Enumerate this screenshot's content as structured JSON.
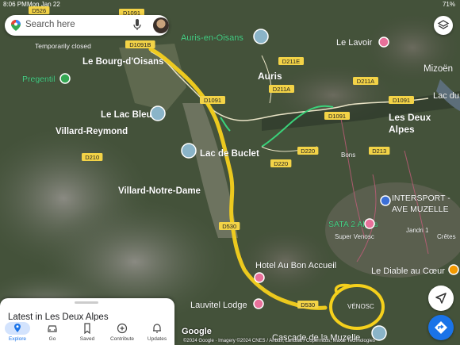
{
  "status_bar": {
    "time": "8:06 PM",
    "date": "Mon Jan 22",
    "battery": "71%"
  },
  "search": {
    "placeholder": "Search here"
  },
  "map": {
    "places": [
      {
        "name": "Le Bourg-d'Oisans",
        "icon": "none"
      },
      {
        "name": "Temporarily closed",
        "icon": "none"
      },
      {
        "name": "Pregentil",
        "icon": "park-icon"
      },
      {
        "name": "Le Lac Bleu",
        "icon": "photo-icon"
      },
      {
        "name": "Villard-Reymond",
        "icon": "none"
      },
      {
        "name": "Lac de Buclet",
        "icon": "photo-icon"
      },
      {
        "name": "Villard-Notre-Dame",
        "icon": "none"
      },
      {
        "name": "Auris-en-Oisans",
        "icon": "photo-icon"
      },
      {
        "name": "Auris",
        "icon": "none"
      },
      {
        "name": "Le Lavoir",
        "icon": "pin-icon"
      },
      {
        "name": "Mizoën",
        "icon": "none"
      },
      {
        "name": "Lac du",
        "icon": "none"
      },
      {
        "name": "Les Deux Alpes",
        "icon": "none"
      },
      {
        "name": "INTERSPORT - AVE MUZELLE",
        "icon": "shop-icon"
      },
      {
        "name": "SATA 2 Alpes",
        "icon": "pin-icon"
      },
      {
        "name": "Super Venosc",
        "icon": "none"
      },
      {
        "name": "Jandri 1",
        "icon": "none"
      },
      {
        "name": "Crêtes",
        "icon": "none"
      },
      {
        "name": "Le Diable au Cœur",
        "icon": "restaurant-icon"
      },
      {
        "name": "Hotel Au Bon Accueil",
        "icon": "hotel-icon"
      },
      {
        "name": "Lauvitel Lodge",
        "icon": "hotel-icon"
      },
      {
        "name": "VÉNOSC",
        "icon": "none"
      },
      {
        "name": "Cascade de la Muzelle",
        "icon": "photo-icon"
      },
      {
        "name": "Bons",
        "icon": "none"
      }
    ],
    "road_labels": [
      "D526",
      "D1091",
      "D1091B",
      "D1091",
      "D211E",
      "D211A",
      "D211A",
      "D1091",
      "D1091",
      "D220",
      "D220",
      "D213",
      "D210",
      "D530",
      "D530"
    ]
  },
  "sheet": {
    "title": "Latest in Les Deux Alpes"
  },
  "tabs": [
    {
      "label": "Explore",
      "icon": "explore-pin-icon",
      "active": true
    },
    {
      "label": "Go",
      "icon": "car-icon",
      "active": false
    },
    {
      "label": "Saved",
      "icon": "bookmark-icon",
      "active": false
    },
    {
      "label": "Contribute",
      "icon": "plus-circle-icon",
      "active": false
    },
    {
      "label": "Updates",
      "icon": "bell-icon",
      "active": false
    }
  ],
  "attribution": {
    "logo": "Google",
    "text": "©2024 Google · Imagery ©2024 CNES / Airbus, Landsat / Copernicus, Maxar Technologies"
  },
  "colors": {
    "highlight": "#f5d01c",
    "terrain": "#44523a",
    "road_shield": "#f3d347",
    "accent": "#1a73e8",
    "trail": "#3ad27a"
  }
}
